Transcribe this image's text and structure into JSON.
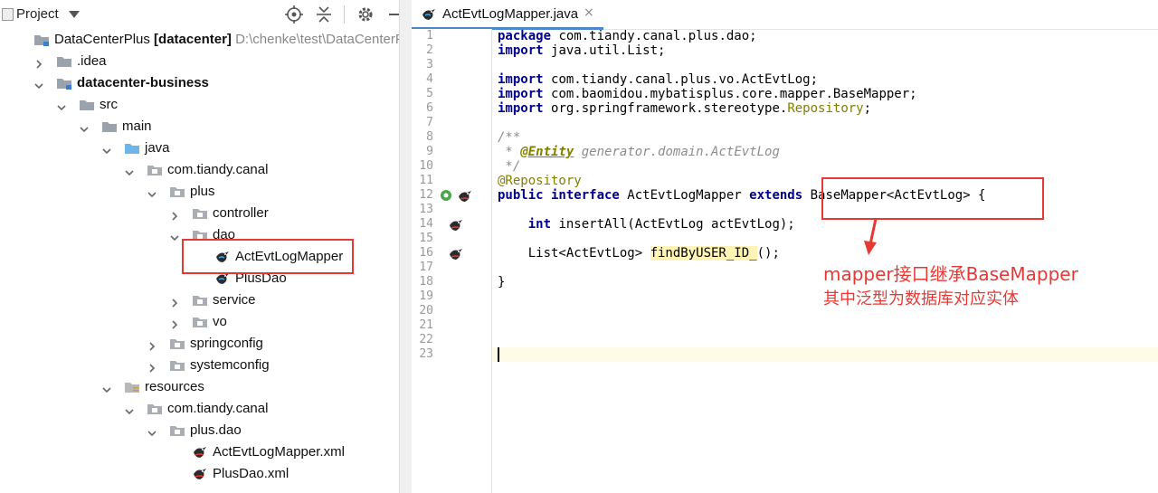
{
  "project_panel": {
    "title": "Project",
    "tree": [
      {
        "label": "DataCenterPlus",
        "suffix": " [datacenter]",
        "path": "  D:\\chenke\\test\\DataCenterPlu",
        "icon": "module-folder-icon",
        "indent": 0,
        "arrow": "none"
      },
      {
        "label": ".idea",
        "icon": "folder-icon",
        "indent": 1,
        "arrow": "right"
      },
      {
        "label": "datacenter-business",
        "icon": "module-folder-icon",
        "indent": 1,
        "arrow": "down",
        "bold": true
      },
      {
        "label": "src",
        "icon": "folder-icon",
        "indent": 2,
        "arrow": "down"
      },
      {
        "label": "main",
        "icon": "folder-icon",
        "indent": 3,
        "arrow": "down"
      },
      {
        "label": "java",
        "icon": "source-folder-icon",
        "indent": 4,
        "arrow": "down"
      },
      {
        "label": "com.tiandy.canal",
        "icon": "package-icon",
        "indent": 5,
        "arrow": "down"
      },
      {
        "label": "plus",
        "icon": "package-icon",
        "indent": 6,
        "arrow": "down"
      },
      {
        "label": "controller",
        "icon": "package-icon",
        "indent": 7,
        "arrow": "right"
      },
      {
        "label": "dao",
        "icon": "package-icon",
        "indent": 7,
        "arrow": "down"
      },
      {
        "label": "ActEvtLogMapper",
        "icon": "mybatis-interface-icon",
        "indent": 8,
        "arrow": "none"
      },
      {
        "label": "PlusDao",
        "icon": "mybatis-interface-icon",
        "indent": 8,
        "arrow": "none"
      },
      {
        "label": "service",
        "icon": "package-icon",
        "indent": 7,
        "arrow": "right"
      },
      {
        "label": "vo",
        "icon": "package-icon",
        "indent": 7,
        "arrow": "right"
      },
      {
        "label": "springconfig",
        "icon": "package-icon",
        "indent": 6,
        "arrow": "right"
      },
      {
        "label": "systemconfig",
        "icon": "package-icon",
        "indent": 6,
        "arrow": "right"
      },
      {
        "label": "resources",
        "icon": "resources-folder-icon",
        "indent": 4,
        "arrow": "down"
      },
      {
        "label": "com.tiandy.canal",
        "icon": "package-icon",
        "indent": 5,
        "arrow": "down"
      },
      {
        "label": "plus.dao",
        "icon": "package-icon",
        "indent": 6,
        "arrow": "down"
      },
      {
        "label": "ActEvtLogMapper.xml",
        "icon": "mybatis-xml-icon",
        "indent": 7,
        "arrow": "none"
      },
      {
        "label": "PlusDao.xml",
        "icon": "mybatis-xml-icon",
        "indent": 7,
        "arrow": "none"
      }
    ]
  },
  "editor": {
    "tab_label": "ActEvtLogMapper.java",
    "tab_close": "×",
    "lines": [
      {
        "n": "1",
        "segs": [
          [
            "kw",
            "package"
          ],
          [
            "",
            "com.tiandy.canal.plus.dao;"
          ]
        ]
      },
      {
        "n": "2",
        "segs": [
          [
            "kw",
            "import"
          ],
          [
            "",
            "java.util.List;"
          ]
        ]
      },
      {
        "n": "3",
        "segs": []
      },
      {
        "n": "4",
        "segs": [
          [
            "kw",
            "import"
          ],
          [
            "",
            "com.tiandy.canal.plus.vo.ActEvtLog;"
          ]
        ]
      },
      {
        "n": "5",
        "segs": [
          [
            "kw",
            "import"
          ],
          [
            "",
            "com.baomidou.mybatisplus.core.mapper.BaseMapper;"
          ]
        ]
      },
      {
        "n": "6",
        "segs": [
          [
            "kw",
            "import"
          ],
          [
            "",
            "org.springframework.stereotype."
          ],
          [
            "ann",
            "Repository"
          ],
          [
            "",
            ";"
          ]
        ]
      },
      {
        "n": "7",
        "segs": []
      },
      {
        "n": "8",
        "segs": [
          [
            "cmt",
            "/**"
          ]
        ]
      },
      {
        "n": "9",
        "segs": [
          [
            "cmt",
            " * "
          ],
          [
            "doc-tag",
            "@Entity"
          ],
          [
            "cmt",
            " generator.domain.ActEvtLog"
          ]
        ]
      },
      {
        "n": "10",
        "segs": [
          [
            "cmt",
            " */"
          ]
        ]
      },
      {
        "n": "11",
        "segs": [
          [
            "ann",
            "@Repository"
          ]
        ]
      },
      {
        "n": "12",
        "segs": [
          [
            "kw",
            "public interface"
          ],
          [
            "",
            " ActEvtLogMapper "
          ],
          [
            "kw",
            "extends"
          ],
          [
            "",
            " BaseMapper<ActEvtLog> {"
          ]
        ]
      },
      {
        "n": "13",
        "segs": []
      },
      {
        "n": "14",
        "segs": [
          [
            "",
            "    "
          ],
          [
            "kw",
            "int"
          ],
          [
            "",
            " insertAll(ActEvtLog actEvtLog);"
          ]
        ]
      },
      {
        "n": "15",
        "segs": []
      },
      {
        "n": "16",
        "segs": [
          [
            "",
            "    List<ActEvtLog> "
          ],
          [
            "hl",
            "findByUSER_ID_"
          ],
          [
            "",
            "();"
          ]
        ]
      },
      {
        "n": "17",
        "segs": []
      },
      {
        "n": "18",
        "segs": [
          [
            "",
            "}"
          ]
        ]
      },
      {
        "n": "19",
        "segs": []
      },
      {
        "n": "20",
        "segs": []
      },
      {
        "n": "21",
        "segs": []
      },
      {
        "n": "22",
        "segs": []
      },
      {
        "n": "23",
        "segs": []
      }
    ]
  },
  "annotation": {
    "line1": "mapper接口继承BaseMapper",
    "line2": "其中泛型为数据库对应实体",
    "color": "#e53935"
  }
}
